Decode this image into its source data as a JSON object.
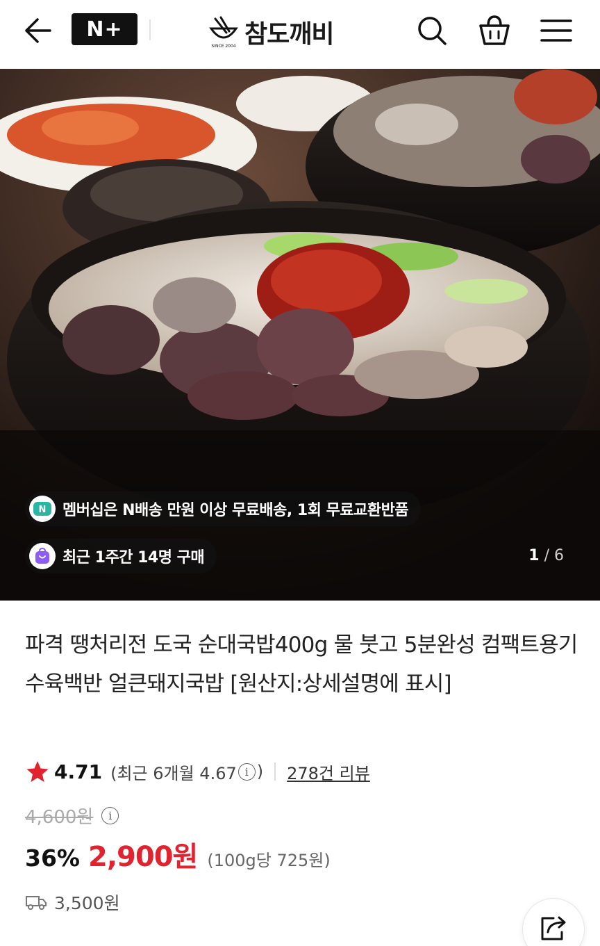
{
  "header": {
    "nplus_label": "N+",
    "brand_name": "참도깨비",
    "brand_since": "SINCE 2004",
    "icons": [
      "back-arrow-icon",
      "search-icon",
      "shopping-bag-icon",
      "hamburger-menu-icon"
    ]
  },
  "hero": {
    "membership_notice": "멤버십은 N배송 만원 이상 무료배송, 1회 무료교환반품",
    "recent_purchases": "최근 1주간 14명 구매",
    "image_counter": {
      "current": "1",
      "separator": "/",
      "total": "6"
    }
  },
  "product": {
    "title": "파격 땡처리전 도국 순대국밥400g 물 붓고 5분완성 컴팩트용기 수육백반 얼큰돼지국밥 [원산지:상세설명에 표시]",
    "rating": "4.71",
    "recent_rating_prefix": "(최근 6개월 4.67",
    "recent_rating_suffix": ")",
    "review_count": "278건 리뷰",
    "original_price": "4,600원",
    "discount_rate": "36%",
    "sale_price": "2,900원",
    "unit_price": "(100g당 725원)",
    "shipping_fee": "3,500원"
  },
  "colors": {
    "sale_price": "#e1222f",
    "star": "#e1222f",
    "header_bg": "#ffffff",
    "nplus_bg": "#111111",
    "membership_icon": "#2bb6a3",
    "purchase_icon": "#8b5cf6"
  }
}
